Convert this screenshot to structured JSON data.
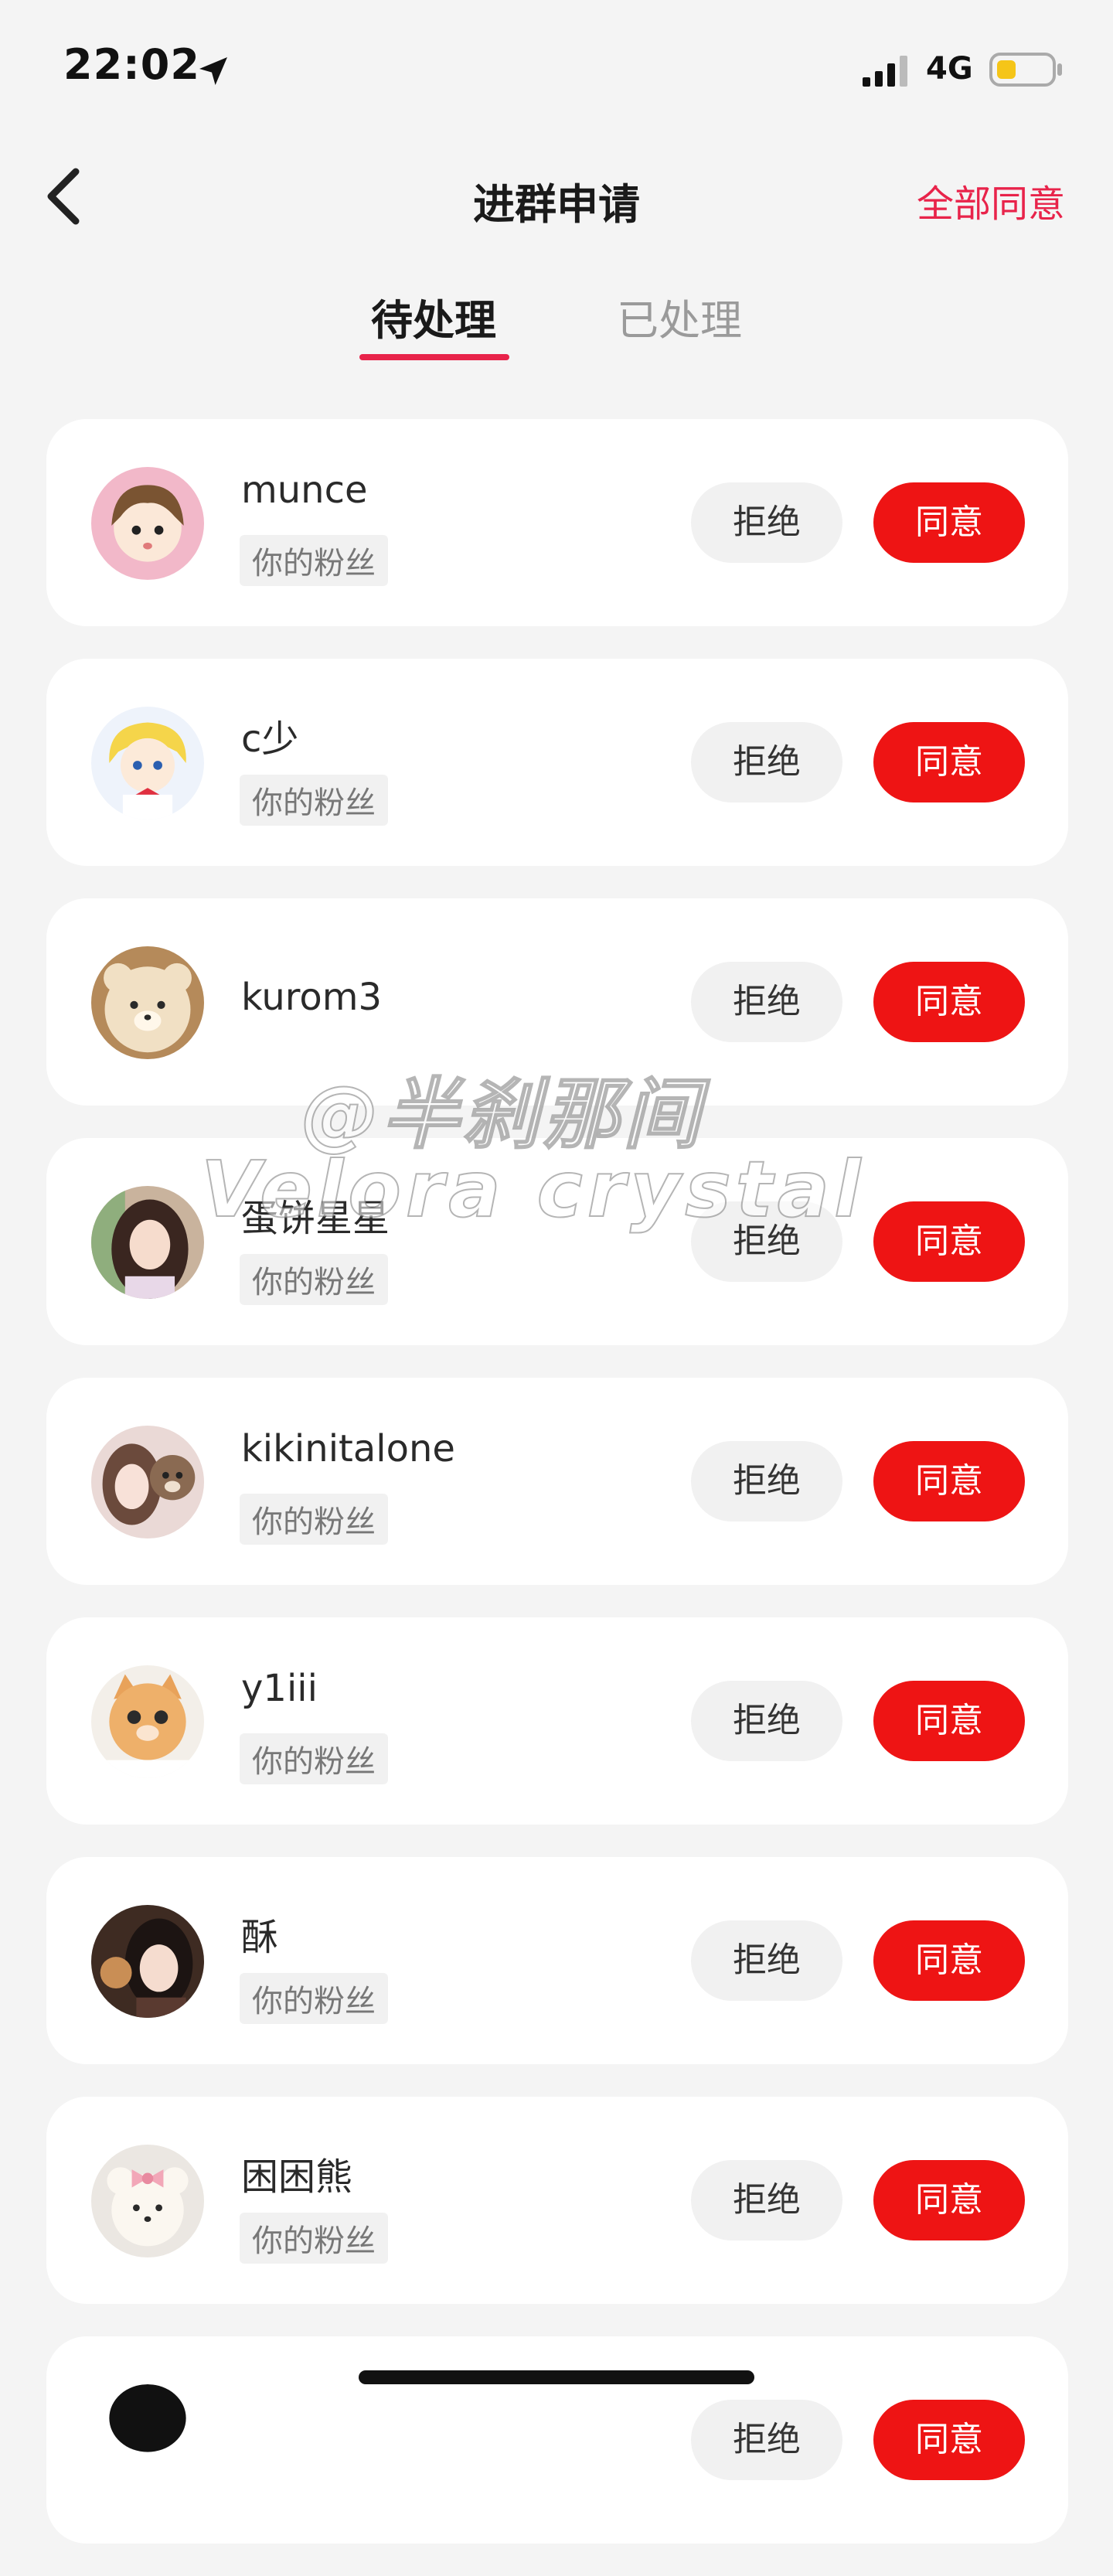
{
  "status_bar": {
    "time": "22:02",
    "network": "4G",
    "battery_color": "#f5c518"
  },
  "nav": {
    "title": "进群申请",
    "agree_all": "全部同意",
    "accent_color": "#e8234a"
  },
  "tabs": [
    {
      "label": "待处理",
      "active": true
    },
    {
      "label": "已处理",
      "active": false
    }
  ],
  "buttons": {
    "reject": "拒绝",
    "agree": "同意"
  },
  "requests": [
    {
      "name": "munce",
      "tag": "你的粉丝",
      "avatar": "anime-girl-avatar"
    },
    {
      "name": "c少",
      "tag": "你的粉丝",
      "avatar": "anime-character-avatar"
    },
    {
      "name": "kurom3",
      "tag": "",
      "avatar": "bear-plush-avatar"
    },
    {
      "name": "蛋饼星星",
      "tag": "你的粉丝",
      "avatar": "girl-photo-avatar"
    },
    {
      "name": "kikinitalone",
      "tag": "你的粉丝",
      "avatar": "girl-with-plush-avatar"
    },
    {
      "name": "y1iii",
      "tag": "你的粉丝",
      "avatar": "kitten-avatar"
    },
    {
      "name": "酥",
      "tag": "你的粉丝",
      "avatar": "girl-portrait-avatar"
    },
    {
      "name": "困困熊",
      "tag": "你的粉丝",
      "avatar": "bear-bow-plush-avatar"
    }
  ],
  "watermark": {
    "line1": "@半刹那间",
    "line2": "Velora crystal"
  }
}
